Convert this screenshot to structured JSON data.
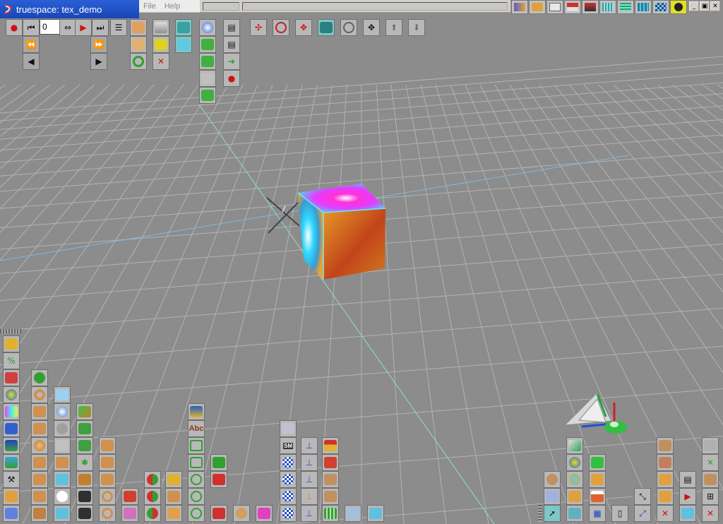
{
  "window": {
    "title": "truespace: tex_demo"
  },
  "menu": [
    {
      "label": "File"
    },
    {
      "label": "Help"
    }
  ],
  "animation": {
    "frame": "0"
  },
  "panel_text": {
    "text_tool_label": "Abc",
    "sm_badge": "SM"
  },
  "colors": {
    "title_bar": "#2055cc",
    "background": "#8c8c8c",
    "grid": "#b0b0b0",
    "toolbar_button": "#b8b8b8",
    "selected_button": "#7fc6c6"
  }
}
